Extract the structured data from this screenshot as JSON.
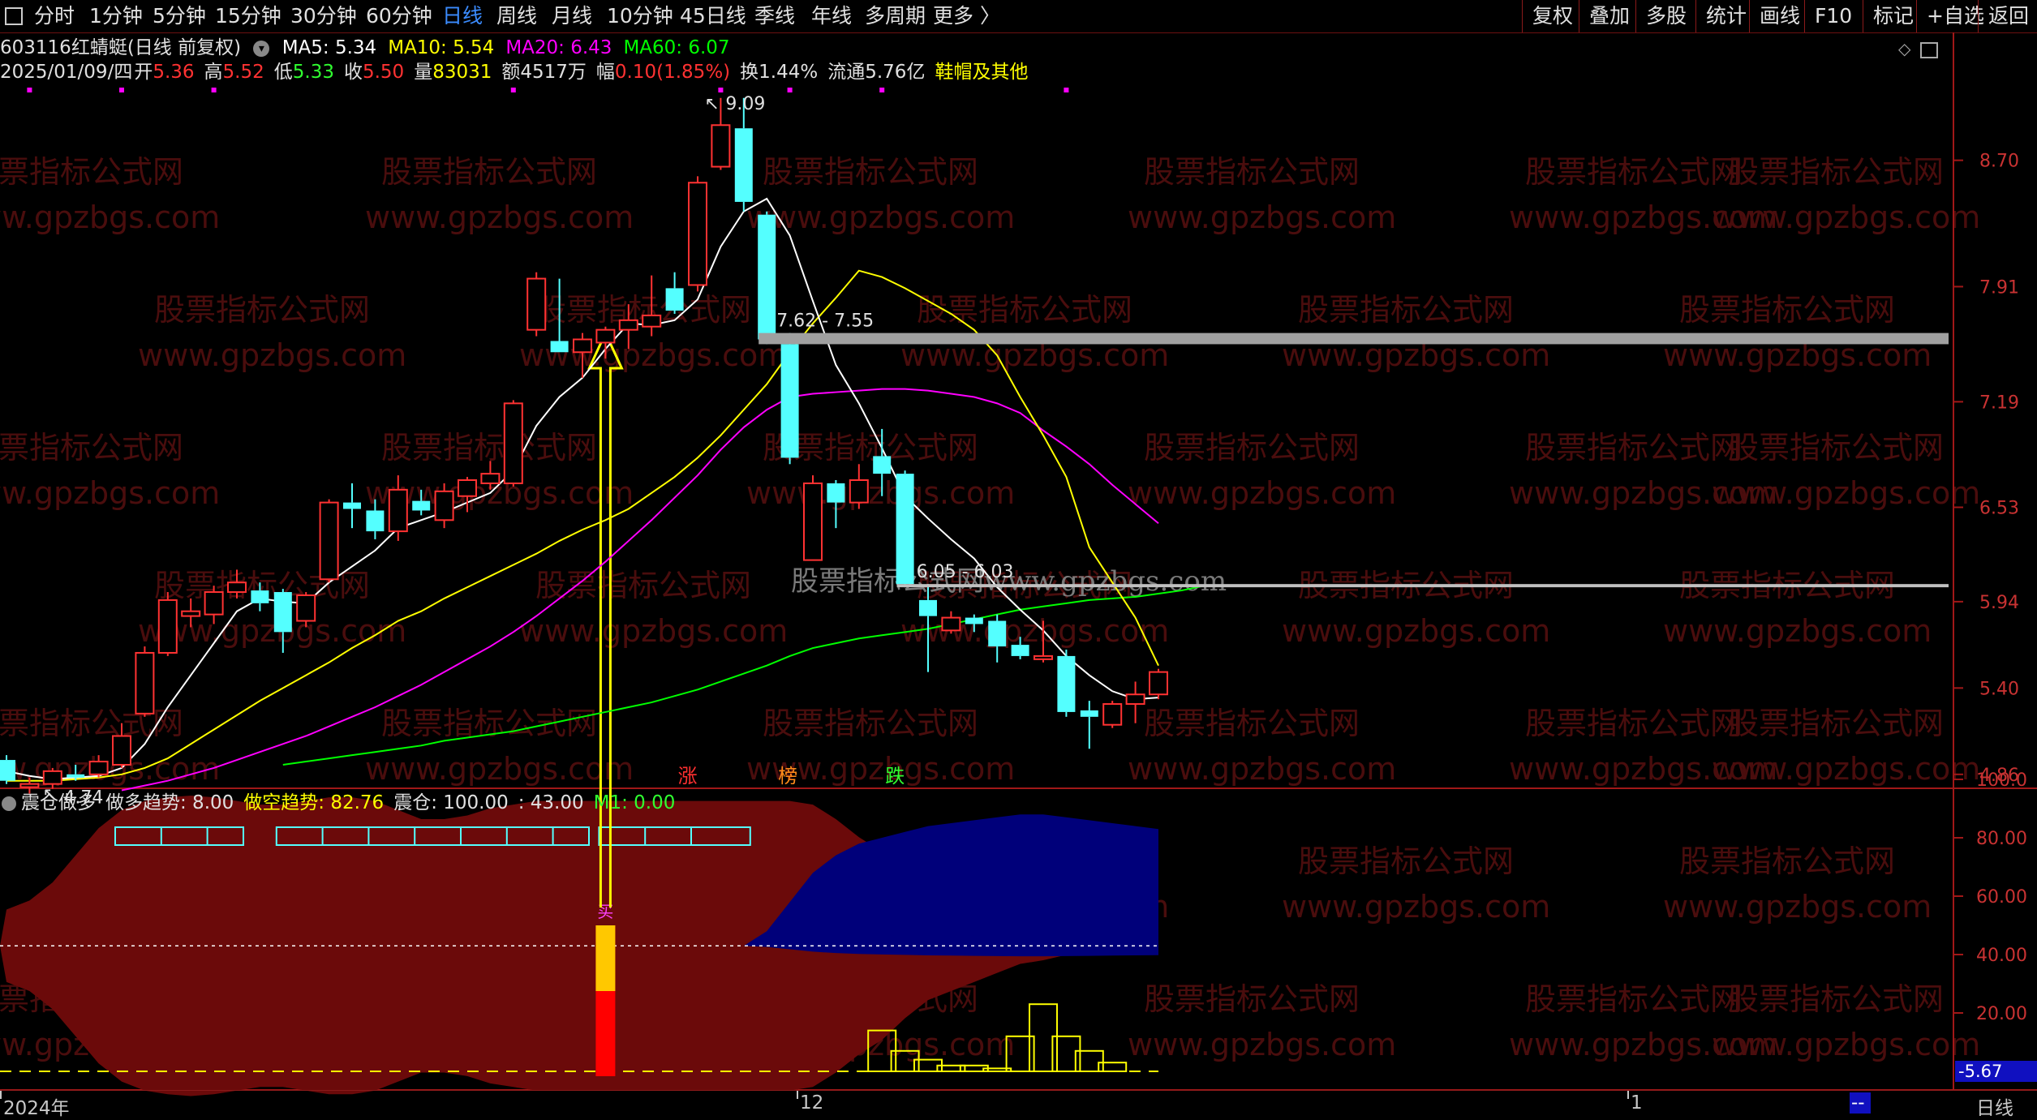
{
  "toolbar": {
    "periods": [
      "分时",
      "1分钟",
      "5分钟",
      "15分钟",
      "30分钟",
      "60分钟",
      "日线",
      "周线",
      "月线",
      "10分钟",
      "45日线",
      "季线",
      "年线",
      "多周期",
      "更多"
    ],
    "active_period": "日线",
    "right_buttons": [
      "复权",
      "叠加",
      "多股",
      "统计",
      "画线",
      "F10",
      "标记",
      "+自选",
      "返回"
    ]
  },
  "stock": {
    "code": "603116",
    "name": "红蜻蜓",
    "mode": "(日线 前复权)",
    "ma": [
      {
        "label": "MA5: 5.34",
        "color": "#ffffff"
      },
      {
        "label": "MA10: 5.54",
        "color": "#ffff00"
      },
      {
        "label": "MA20: 6.43",
        "color": "#ff00ff"
      },
      {
        "label": "MA60: 6.07",
        "color": "#00ff00"
      }
    ]
  },
  "ohlc": {
    "date": "2025/01/09/四",
    "open_label": "开",
    "open": "5.36",
    "high_label": "高",
    "high": "5.52",
    "low_label": "低",
    "low": "5.33",
    "close_label": "收",
    "close": "5.50",
    "vol_label": "量",
    "vol": "83031",
    "amount": "额4517万",
    "change_label": "幅",
    "change": "0.10(1.85%)",
    "turnover": "换1.44%",
    "float_cap": "流通5.76亿",
    "sector": "鞋帽及其他"
  },
  "indicator": {
    "name": "震仓做多",
    "long_trend": "做多趋势: 8.00",
    "short_trend": "做空趋势: 82.76",
    "shake": "震仓: 100.00",
    "level": ": 43.00",
    "m1": "M1: 0.00",
    "buy_mark": "买",
    "current_value": "-5.67"
  },
  "price_axis": [
    "8.70",
    "7.91",
    "7.19",
    "6.53",
    "5.94",
    "5.40",
    "4.86"
  ],
  "indicator_axis": [
    "100.0",
    "80.00",
    "60.00",
    "40.00",
    "20.00"
  ],
  "date_axis": {
    "start": "2024年",
    "mid": "12",
    "end": "1",
    "end_value": "--",
    "period": "日线"
  },
  "annotations": {
    "high": "9.09",
    "low": "4.74",
    "gap1": "7.62 - 7.55",
    "gap2": "6.05 - 6.03",
    "events": [
      {
        "text": "涨",
        "color": "#ff3030"
      },
      {
        "text": "榜",
        "color": "#ff8c1a"
      },
      {
        "text": "跌",
        "color": "#30ff30"
      }
    ]
  },
  "watermark": {
    "text": "股票指标公式网",
    "url": "www.gpzbgs.com",
    "center": "股票指标公式网www.gpzbgs.com"
  },
  "colors": {
    "up": "#ff3232",
    "down": "#54ffff",
    "bull_area": "#6b0a0a",
    "bear_area": "#00007a"
  },
  "chart_data": {
    "type": "candlestick",
    "candles": [
      {
        "o": 4.95,
        "h": 4.98,
        "l": 4.8,
        "c": 4.82
      },
      {
        "o": 4.78,
        "h": 4.84,
        "l": 4.74,
        "c": 4.8
      },
      {
        "o": 4.8,
        "h": 4.9,
        "l": 4.77,
        "c": 4.88
      },
      {
        "o": 4.86,
        "h": 4.92,
        "l": 4.82,
        "c": 4.84
      },
      {
        "o": 4.86,
        "h": 4.98,
        "l": 4.84,
        "c": 4.94
      },
      {
        "o": 4.92,
        "h": 5.18,
        "l": 4.9,
        "c": 5.1
      },
      {
        "o": 5.24,
        "h": 5.66,
        "l": 5.22,
        "c": 5.62
      },
      {
        "o": 5.62,
        "h": 6.0,
        "l": 5.6,
        "c": 5.95
      },
      {
        "o": 5.85,
        "h": 5.96,
        "l": 5.78,
        "c": 5.88
      },
      {
        "o": 5.86,
        "h": 6.04,
        "l": 5.8,
        "c": 6.0
      },
      {
        "o": 6.0,
        "h": 6.14,
        "l": 5.96,
        "c": 6.06
      },
      {
        "o": 6.01,
        "h": 6.06,
        "l": 5.88,
        "c": 5.93
      },
      {
        "o": 6.0,
        "h": 6.02,
        "l": 5.62,
        "c": 5.75
      },
      {
        "o": 5.82,
        "h": 6.0,
        "l": 5.78,
        "c": 5.98
      },
      {
        "o": 6.08,
        "h": 6.58,
        "l": 6.06,
        "c": 6.56
      },
      {
        "o": 6.56,
        "h": 6.68,
        "l": 6.4,
        "c": 6.52
      },
      {
        "o": 6.51,
        "h": 6.58,
        "l": 6.33,
        "c": 6.38
      },
      {
        "o": 6.38,
        "h": 6.73,
        "l": 6.32,
        "c": 6.64
      },
      {
        "o": 6.57,
        "h": 6.64,
        "l": 6.48,
        "c": 6.51
      },
      {
        "o": 6.45,
        "h": 6.68,
        "l": 6.4,
        "c": 6.63
      },
      {
        "o": 6.6,
        "h": 6.72,
        "l": 6.5,
        "c": 6.7
      },
      {
        "o": 6.68,
        "h": 6.82,
        "l": 6.64,
        "c": 6.74
      },
      {
        "o": 6.68,
        "h": 7.2,
        "l": 6.66,
        "c": 7.18
      },
      {
        "o": 7.64,
        "h": 8.0,
        "l": 7.6,
        "c": 7.96
      },
      {
        "o": 7.57,
        "h": 7.96,
        "l": 7.5,
        "c": 7.5
      },
      {
        "o": 7.5,
        "h": 7.62,
        "l": 7.34,
        "c": 7.58
      },
      {
        "o": 7.56,
        "h": 7.66,
        "l": 7.46,
        "c": 7.64
      },
      {
        "o": 7.64,
        "h": 7.8,
        "l": 7.52,
        "c": 7.7
      },
      {
        "o": 7.66,
        "h": 7.98,
        "l": 7.6,
        "c": 7.73
      },
      {
        "o": 7.9,
        "h": 8.0,
        "l": 7.74,
        "c": 7.76
      },
      {
        "o": 7.92,
        "h": 8.6,
        "l": 7.88,
        "c": 8.56
      },
      {
        "o": 8.66,
        "h": 9.09,
        "l": 8.64,
        "c": 8.92
      },
      {
        "o": 8.9,
        "h": 9.09,
        "l": 8.38,
        "c": 8.44
      },
      {
        "o": 8.36,
        "h": 8.38,
        "l": 7.55,
        "c": 7.58
      },
      {
        "o": 7.55,
        "h": 7.62,
        "l": 6.8,
        "c": 6.84
      },
      {
        "o": 6.2,
        "h": 6.73,
        "l": 6.2,
        "c": 6.68
      },
      {
        "o": 6.68,
        "h": 6.7,
        "l": 6.4,
        "c": 6.56
      },
      {
        "o": 6.56,
        "h": 6.8,
        "l": 6.52,
        "c": 6.7
      },
      {
        "o": 6.85,
        "h": 7.02,
        "l": 6.6,
        "c": 6.74
      },
      {
        "o": 6.74,
        "h": 6.76,
        "l": 6.03,
        "c": 6.05
      },
      {
        "o": 5.95,
        "h": 6.05,
        "l": 5.5,
        "c": 5.85
      },
      {
        "o": 5.76,
        "h": 5.88,
        "l": 5.74,
        "c": 5.84
      },
      {
        "o": 5.84,
        "h": 5.86,
        "l": 5.75,
        "c": 5.8
      },
      {
        "o": 5.82,
        "h": 5.86,
        "l": 5.56,
        "c": 5.66
      },
      {
        "o": 5.67,
        "h": 5.72,
        "l": 5.58,
        "c": 5.6
      },
      {
        "o": 5.58,
        "h": 5.82,
        "l": 5.56,
        "c": 5.6
      },
      {
        "o": 5.6,
        "h": 5.64,
        "l": 5.22,
        "c": 5.25
      },
      {
        "o": 5.26,
        "h": 5.32,
        "l": 5.02,
        "c": 5.22
      },
      {
        "o": 5.17,
        "h": 5.32,
        "l": 5.15,
        "c": 5.3
      },
      {
        "o": 5.3,
        "h": 5.44,
        "l": 5.18,
        "c": 5.36
      },
      {
        "o": 5.36,
        "h": 5.52,
        "l": 5.33,
        "c": 5.5
      }
    ],
    "ma5": [
      4.88,
      4.85,
      4.83,
      4.84,
      4.85,
      4.9,
      5.05,
      5.28,
      5.48,
      5.68,
      5.88,
      5.96,
      5.94,
      5.93,
      6.06,
      6.16,
      6.26,
      6.4,
      6.45,
      6.5,
      6.56,
      6.62,
      6.76,
      7.04,
      7.22,
      7.34,
      7.52,
      7.68,
      7.67,
      7.7,
      7.83,
      8.16,
      8.38,
      8.46,
      8.23,
      7.82,
      7.42,
      7.18,
      6.9,
      6.6,
      6.46,
      6.33,
      6.21,
      6.03,
      5.89,
      5.76,
      5.6,
      5.48,
      5.38,
      5.33,
      5.34
    ],
    "ma10": [
      4.82,
      4.82,
      4.82,
      4.83,
      4.84,
      4.86,
      4.9,
      4.96,
      5.05,
      5.14,
      5.23,
      5.32,
      5.4,
      5.48,
      5.56,
      5.65,
      5.73,
      5.82,
      5.88,
      5.96,
      6.03,
      6.1,
      6.17,
      6.24,
      6.32,
      6.39,
      6.45,
      6.52,
      6.62,
      6.72,
      6.84,
      6.98,
      7.14,
      7.3,
      7.5,
      7.68,
      7.84,
      8.01,
      7.97,
      7.9,
      7.82,
      7.74,
      7.64,
      7.48,
      7.22,
      6.98,
      6.72,
      6.28,
      6.06,
      5.84,
      5.54
    ],
    "ma20": [
      null,
      null,
      null,
      null,
      null,
      4.76,
      4.79,
      4.82,
      4.86,
      4.9,
      4.95,
      5.0,
      5.05,
      5.1,
      5.16,
      5.22,
      5.28,
      5.35,
      5.42,
      5.5,
      5.58,
      5.66,
      5.75,
      5.85,
      5.96,
      6.07,
      6.19,
      6.32,
      6.45,
      6.59,
      6.73,
      6.89,
      7.03,
      7.14,
      7.22,
      7.24,
      7.25,
      7.26,
      7.27,
      7.27,
      7.26,
      7.24,
      7.22,
      7.18,
      7.12,
      7.01,
      6.91,
      6.8,
      6.67,
      6.55,
      6.43
    ],
    "ma60_start_index": 12,
    "ma60": [
      4.92,
      4.94,
      4.96,
      4.98,
      5.0,
      5.02,
      5.04,
      5.07,
      5.09,
      5.11,
      5.13,
      5.16,
      5.19,
      5.22,
      5.25,
      5.28,
      5.31,
      5.35,
      5.39,
      5.44,
      5.49,
      5.54,
      5.6,
      5.65,
      5.68,
      5.71,
      5.73,
      5.75,
      5.77,
      5.8,
      5.83,
      5.86,
      5.89,
      5.91,
      5.93,
      5.95,
      5.96,
      5.97,
      5.99,
      6.01,
      6.04
    ],
    "long_trend": [
      30,
      35,
      45,
      60,
      75,
      85,
      90,
      92,
      93,
      92,
      90,
      88,
      88,
      90,
      92,
      92,
      90,
      85,
      80,
      80,
      82,
      86,
      88,
      90,
      90,
      90,
      90,
      90,
      90,
      90,
      90,
      90,
      90,
      90,
      90,
      88,
      80,
      70,
      62,
      50,
      40,
      35,
      30,
      25,
      20,
      18,
      15,
      12,
      10,
      8,
      8
    ],
    "short_trend": [
      null,
      null,
      null,
      null,
      null,
      null,
      null,
      null,
      null,
      null,
      null,
      null,
      null,
      null,
      null,
      null,
      null,
      null,
      null,
      null,
      null,
      null,
      null,
      null,
      null,
      null,
      null,
      null,
      null,
      null,
      null,
      null,
      42,
      48,
      58,
      68,
      74,
      78,
      80,
      82,
      84,
      85,
      86,
      87,
      88,
      88,
      87,
      86,
      85,
      84,
      83
    ],
    "box_bars": [
      null,
      null,
      null,
      null,
      null,
      null,
      null,
      null,
      null,
      null,
      null,
      null,
      null,
      null,
      null,
      null,
      null,
      null,
      null,
      null,
      null,
      null,
      null,
      null,
      null,
      null,
      null,
      null,
      null,
      null,
      null,
      null,
      null,
      null,
      null,
      null,
      null,
      null,
      14,
      7,
      4,
      2,
      2,
      1,
      12,
      23,
      12,
      7,
      3
    ],
    "buy_signal_index": 26,
    "buy_signal_value": 50,
    "y_price_ticks": [
      8.7,
      7.91,
      7.19,
      6.53,
      5.94,
      5.4,
      4.86
    ],
    "y_indicator_ticks": [
      100,
      80,
      60,
      40,
      20
    ],
    "indicator_level": 43
  }
}
